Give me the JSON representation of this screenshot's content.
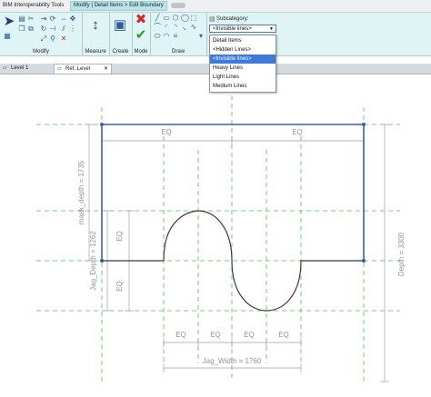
{
  "ribbon_tabs": {
    "bim": "BIM Interoperability Tools",
    "modify": "Modify | Detail Items > Edit Boundary"
  },
  "panels": {
    "modify": "Modify",
    "measure": "Measure",
    "create": "Create",
    "mode": "Mode",
    "draw": "Draw"
  },
  "subcategory": {
    "label": "Subcategory:",
    "selected": "<Invisible lines>",
    "options": [
      "Detail Items",
      "<Hidden Lines>",
      "<Invisible lines>",
      "Heavy Lines",
      "Light Lines",
      "Medium Lines"
    ],
    "selected_index": 2
  },
  "view_tabs": [
    "Level 1",
    "Ref. Level"
  ],
  "active_view_tab": 1,
  "drawing": {
    "eq": "EQ",
    "dims": {
      "mask_depth": "mask_depth = 1735",
      "jag_depth": "Jag_Depth = 1262",
      "depth": "Depth = 3300",
      "jag_width": "Jag_Width = 1760"
    }
  },
  "icons": {
    "modify_arrow": "cursor-arrow-icon",
    "mode_finish": "green-check-icon",
    "mode_cancel": "red-x-icon"
  },
  "colors": {
    "ribbon_bg": "#dff5f5",
    "boundary": "#3b5fb0",
    "dim": "#9aa0a5",
    "refplane": "#3fbf3f"
  }
}
